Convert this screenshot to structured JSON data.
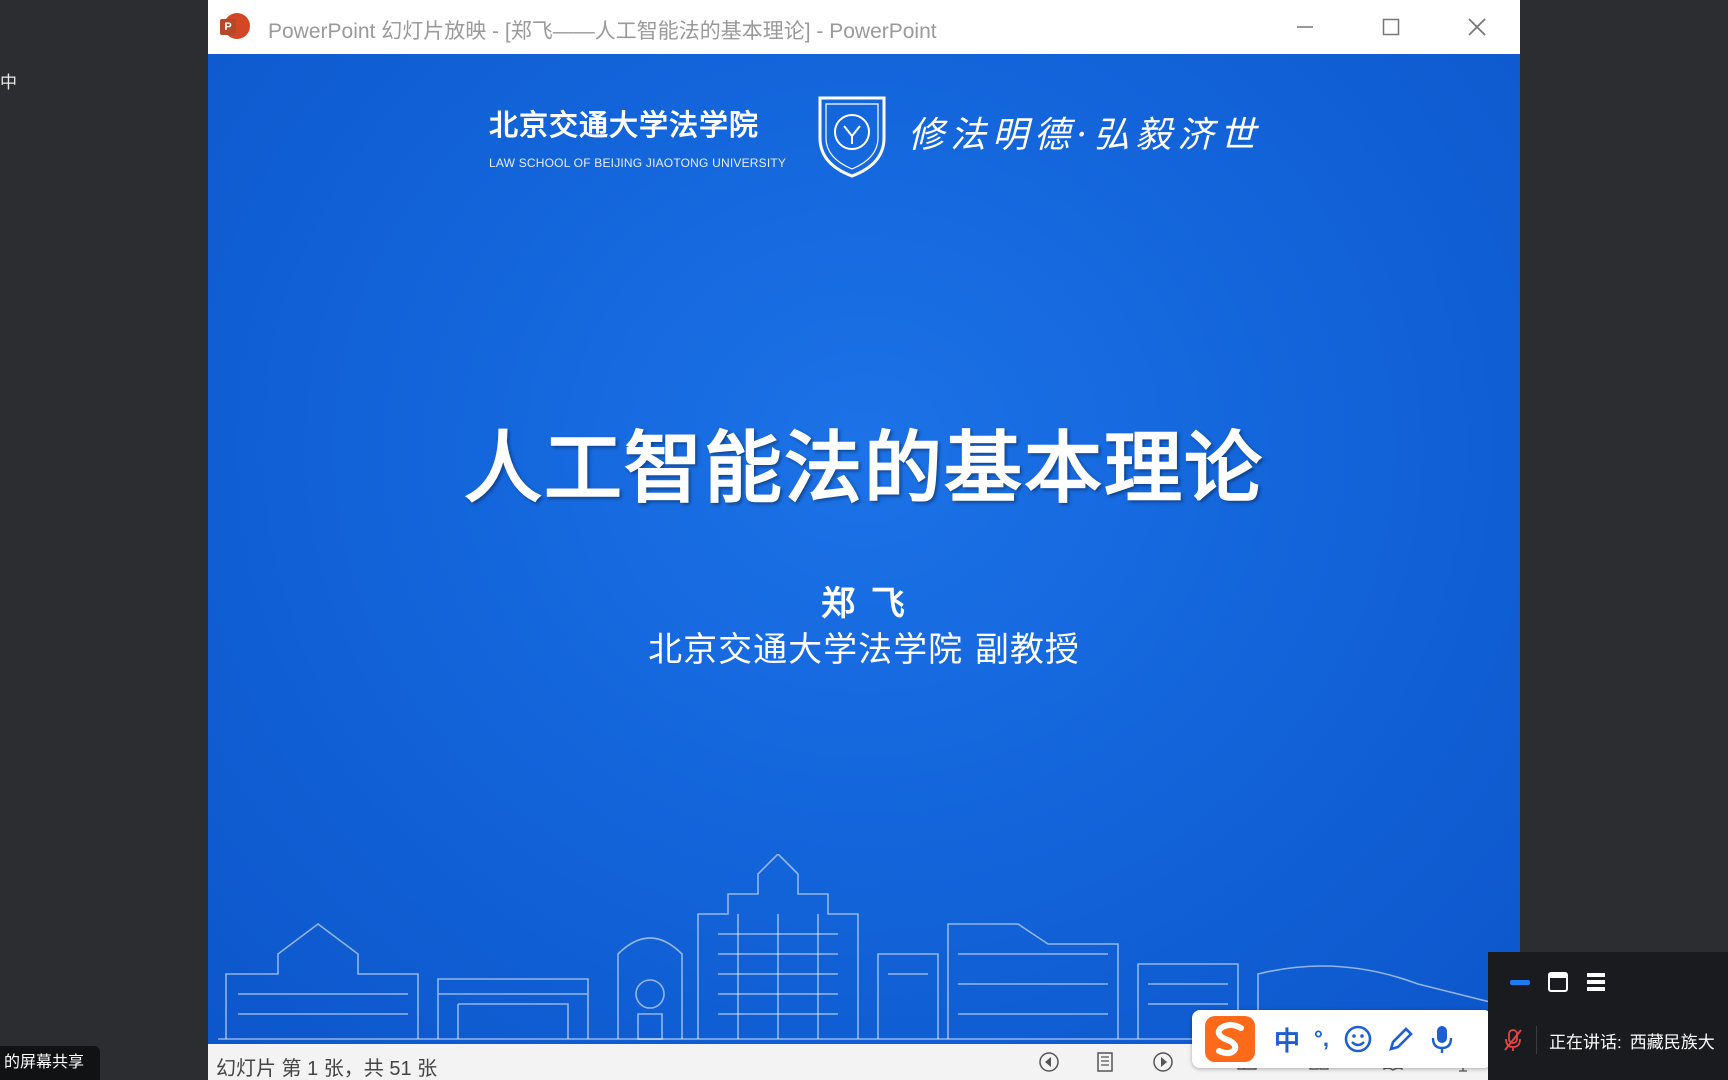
{
  "background_app": {
    "left_text": "中",
    "share_label": "的屏幕共享"
  },
  "window": {
    "title": "PowerPoint 幻灯片放映 - [郑飞——人工智能法的基本理论] - PowerPoint",
    "logo_letter": "P"
  },
  "slide": {
    "school_cn": "北京交通大学法学院",
    "school_en": "LAW SCHOOL OF BEIJING JIAOTONG UNIVERSITY",
    "motto": "修法明德·弘毅济世",
    "title": "人工智能法的基本理论",
    "author": "郑 飞",
    "affiliation": "北京交通大学法学院 副教授"
  },
  "statusbar": {
    "slide_info": "幻灯片 第 1 张，共 51 张"
  },
  "ime": {
    "mode": "中",
    "punct": "°,"
  },
  "meeting": {
    "speaking_label": "正在讲话:",
    "speaker": "西藏民族大"
  },
  "colors": {
    "slide_blue": "#1262d8",
    "ppt_orange": "#d24726",
    "ime_blue": "#1d5fd3"
  }
}
